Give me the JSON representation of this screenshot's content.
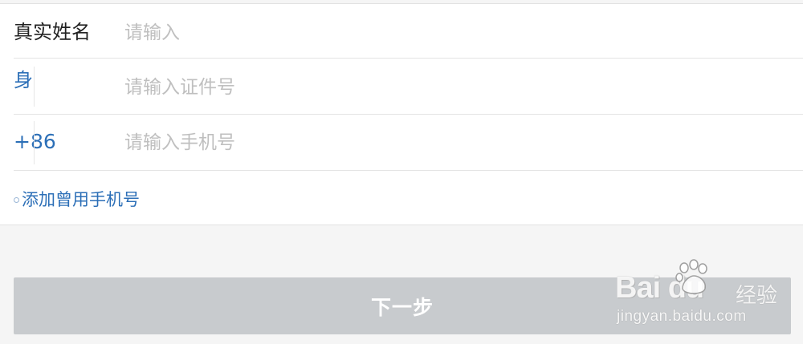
{
  "form": {
    "name": {
      "label": "真实姓名",
      "placeholder": "请输入",
      "value": ""
    },
    "id": {
      "label": "身",
      "placeholder": "请输入证件号",
      "value": ""
    },
    "phone": {
      "label": "+86",
      "placeholder": "请输入手机号",
      "value": ""
    },
    "add_phone": {
      "label": "添加曾用手机号"
    }
  },
  "actions": {
    "next_label": "下一步"
  },
  "watermark": {
    "brand": "Bai du",
    "brand_suffix": "经验",
    "url": "jingyan.baidu.com"
  },
  "colors": {
    "link_blue": "#2c6fb7",
    "button_disabled": "#c8cbce",
    "placeholder": "#bfbfbf",
    "background": "#f5f5f5"
  }
}
